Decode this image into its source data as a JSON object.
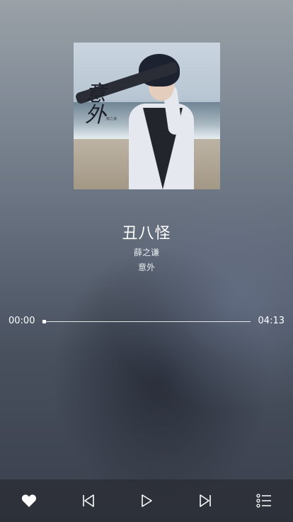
{
  "song": {
    "title": "丑八怪",
    "artist": "薛之谦",
    "album": "意外"
  },
  "cover": {
    "calligraphy": "意外",
    "tiny_text": "薛之谦"
  },
  "progress": {
    "current": "00:00",
    "total": "04:13",
    "fraction": 0
  },
  "controls": {
    "like_icon": "heart-icon",
    "prev_icon": "skip-back-icon",
    "play_icon": "play-icon",
    "next_icon": "skip-forward-icon",
    "playlist_icon": "playlist-icon"
  },
  "colors": {
    "text": "#ffffff",
    "bar": "#22242a"
  }
}
